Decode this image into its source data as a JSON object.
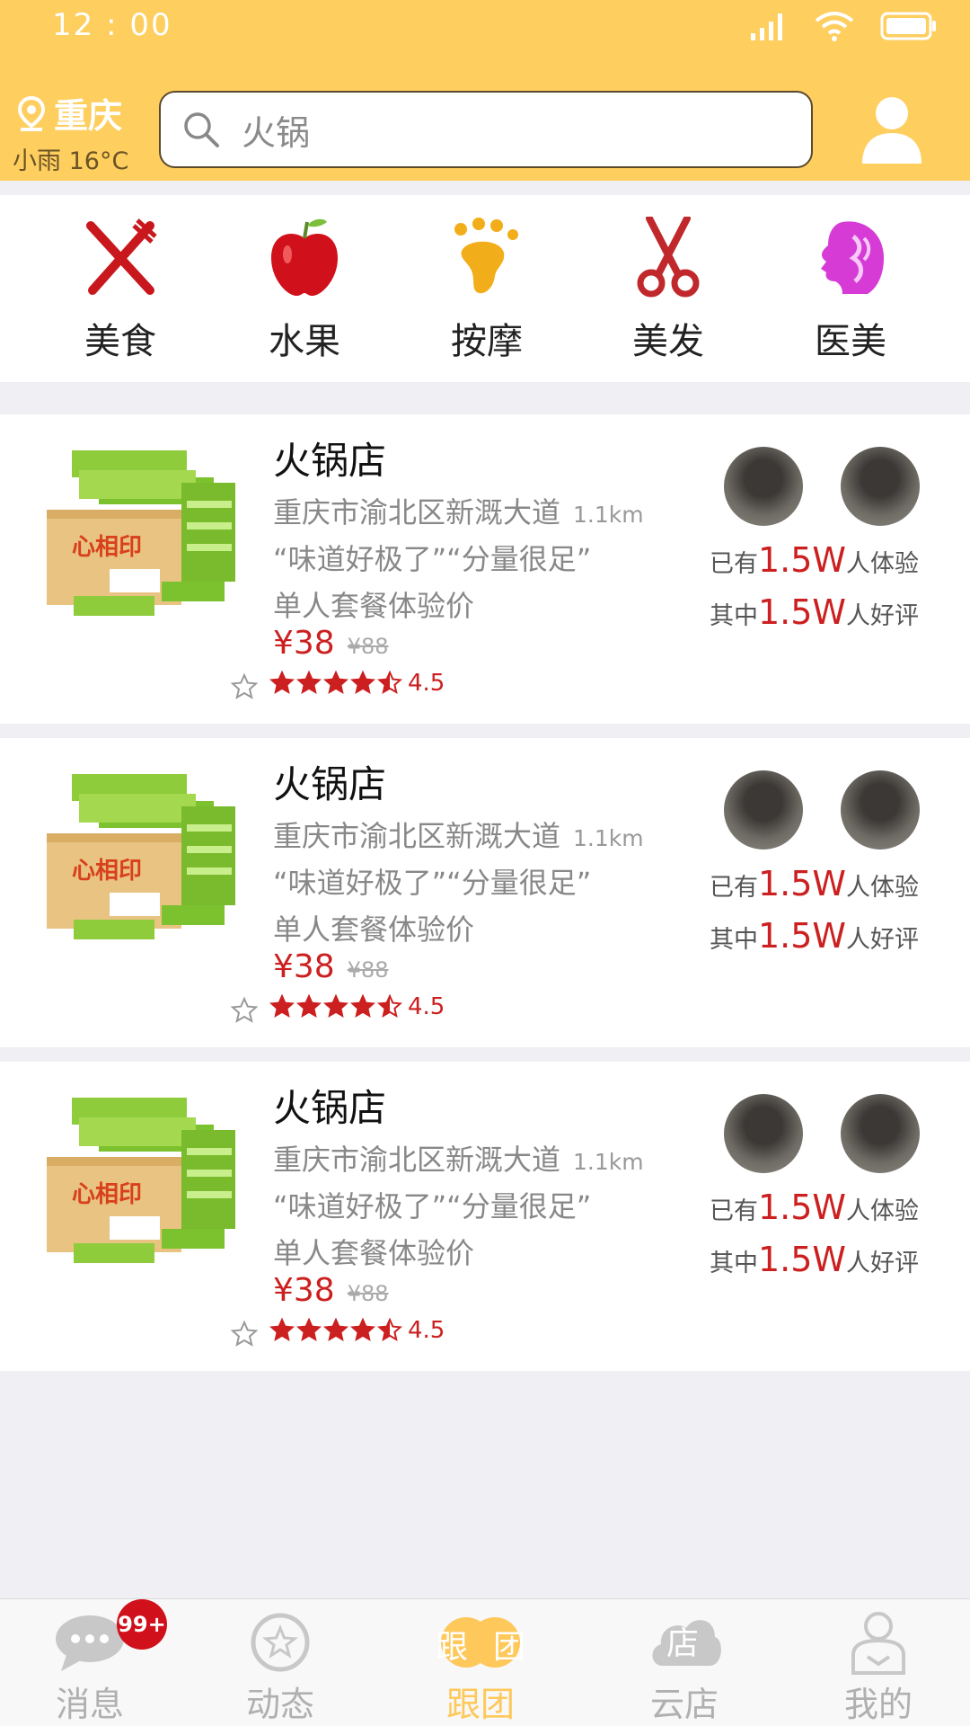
{
  "status_bar": {
    "time": "12 : 00"
  },
  "header": {
    "city": "重庆",
    "weather": "小雨 16°C",
    "search_text": "火锅"
  },
  "categories": [
    {
      "label": "美食",
      "icon": "fork-knife-icon"
    },
    {
      "label": "水果",
      "icon": "apple-icon"
    },
    {
      "label": "按摩",
      "icon": "foot-icon"
    },
    {
      "label": "美发",
      "icon": "scissors-icon"
    },
    {
      "label": "医美",
      "icon": "face-profile-icon"
    }
  ],
  "listings": [
    {
      "name": "火锅店",
      "address": "重庆市渝北区新溉大道",
      "distance": "1.1km",
      "quote": "“味道好极了”“分量很足”",
      "deal": "单人套餐体验价",
      "price": "¥38",
      "original_price": "¥88",
      "rating": "4.5",
      "experienced_prefix": "已有",
      "experienced_count": "1.5W",
      "experienced_suffix": "人体验",
      "good_prefix": "其中",
      "good_count": "1.5W",
      "good_suffix": "人好评"
    },
    {
      "name": "火锅店",
      "address": "重庆市渝北区新溉大道",
      "distance": "1.1km",
      "quote": "“味道好极了”“分量很足”",
      "deal": "单人套餐体验价",
      "price": "¥38",
      "original_price": "¥88",
      "rating": "4.5",
      "experienced_prefix": "已有",
      "experienced_count": "1.5W",
      "experienced_suffix": "人体验",
      "good_prefix": "其中",
      "good_count": "1.5W",
      "good_suffix": "人好评"
    },
    {
      "name": "火锅店",
      "address": "重庆市渝北区新溉大道",
      "distance": "1.1km",
      "quote": "“味道好极了”“分量很足”",
      "deal": "单人套餐体验价",
      "price": "¥38",
      "original_price": "¥88",
      "rating": "4.5",
      "experienced_prefix": "已有",
      "experienced_count": "1.5W",
      "experienced_suffix": "人体验",
      "good_prefix": "其中",
      "good_count": "1.5W",
      "good_suffix": "人好评"
    }
  ],
  "tabbar": {
    "badge": "99+",
    "tabs": [
      {
        "label": "消息",
        "icon": "chat-bubble-icon",
        "active": false
      },
      {
        "label": "动态",
        "icon": "star-circle-icon",
        "active": false
      },
      {
        "label": "跟团",
        "icon": "group-tour-icon",
        "active": true,
        "icon_text_1": "跟",
        "icon_text_2": "团"
      },
      {
        "label": "云店",
        "icon": "cloud-store-icon",
        "active": false,
        "icon_text": "店"
      },
      {
        "label": "我的",
        "icon": "user-icon",
        "active": false
      }
    ]
  },
  "colors": {
    "brand_yellow": "#fece5f",
    "price_red": "#cc1f1f",
    "badge_red": "#d0101b"
  }
}
